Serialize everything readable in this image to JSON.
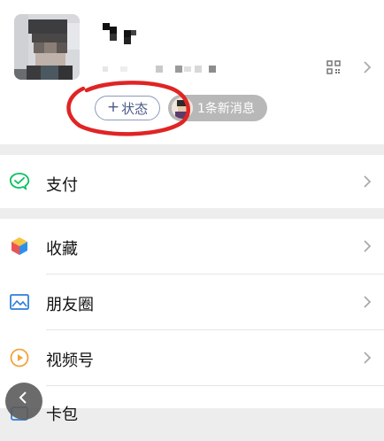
{
  "profile": {
    "status_button": {
      "plus": "+",
      "label": "状态"
    },
    "new_message": "1条新消息",
    "icons": {
      "qr": "qr-code-icon",
      "chevron": "chevron-right-icon"
    }
  },
  "menu": {
    "pay": {
      "label": "支付",
      "icon": "wechat-pay-icon"
    },
    "favorites": {
      "label": "收藏",
      "icon": "favorites-cube-icon"
    },
    "moments": {
      "label": "朋友圈",
      "icon": "moments-picture-icon"
    },
    "channels": {
      "label": "视频号",
      "icon": "channels-play-icon"
    },
    "cards": {
      "label": "卡包",
      "icon": "cards-icon"
    }
  },
  "colors": {
    "pay_green": "#07c160",
    "annotation_red": "#e02424",
    "status_text": "#4a5b87",
    "background": "#ededed"
  }
}
